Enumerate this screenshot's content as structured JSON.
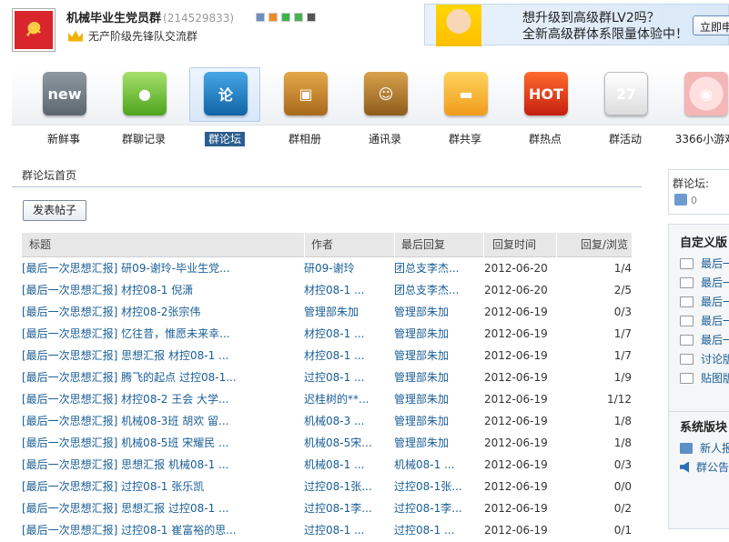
{
  "group": {
    "name": "机械毕业生党员群",
    "id": "(214529833)",
    "subtitle": "无产阶级先锋队交流群"
  },
  "banner": {
    "line1": "想升级到高级群LV2吗？",
    "line2": "全新高级群体系限量体验中！",
    "button": "立即申"
  },
  "tools": [
    {
      "label": "新鲜事",
      "icon": "new-icon",
      "glyph": "new"
    },
    {
      "label": "群聊记录",
      "icon": "chat-icon",
      "glyph": "●"
    },
    {
      "label": "群论坛",
      "icon": "forum-icon",
      "glyph": "论"
    },
    {
      "label": "群相册",
      "icon": "album-icon",
      "glyph": "▣"
    },
    {
      "label": "通讯录",
      "icon": "contacts-icon",
      "glyph": "☺"
    },
    {
      "label": "群共享",
      "icon": "share-icon",
      "glyph": "▬"
    },
    {
      "label": "群热点",
      "icon": "hot-icon",
      "glyph": "HOT"
    },
    {
      "label": "群活动",
      "icon": "event-icon",
      "glyph": "27"
    },
    {
      "label": "3366小游戏",
      "icon": "game-icon",
      "glyph": "◉"
    }
  ],
  "breadcrumb": "群论坛首页",
  "post_button": "发表帖子",
  "table": {
    "headers": [
      "标题",
      "作者",
      "最后回复",
      "回复时间",
      "回复/浏览"
    ],
    "rows": [
      [
        "[最后一次思想汇报] 研09-谢玲-毕业生党...",
        "研09-谢玲",
        "团总支李杰...",
        "2012-06-20",
        "1/4"
      ],
      [
        "[最后一次思想汇报] 材控08-1 倪潇",
        "材控08-1 ...",
        "团总支李杰...",
        "2012-06-20",
        "2/5"
      ],
      [
        "[最后一次思想汇报] 材控08-2张宗伟",
        "管理部朱加",
        "管理部朱加",
        "2012-06-19",
        "0/3"
      ],
      [
        "[最后一次思想汇报] 忆往昔，惟愿未来幸...",
        "材控08-1 ...",
        "管理部朱加",
        "2012-06-19",
        "1/7"
      ],
      [
        "[最后一次思想汇报] 思想汇报 材控08-1 ...",
        "材控08-1 ...",
        "管理部朱加",
        "2012-06-19",
        "1/7"
      ],
      [
        "[最后一次思想汇报] 腾飞的起点 过控08-1...",
        "过控08-1 ...",
        "管理部朱加",
        "2012-06-19",
        "1/9"
      ],
      [
        "[最后一次思想汇报] 材控08-2 王会 大学...",
        "迟桂树的**...",
        "管理部朱加",
        "2012-06-19",
        "1/12"
      ],
      [
        "[最后一次思想汇报] 机械08-3班 胡欢 留...",
        "机械08-3 ...",
        "管理部朱加",
        "2012-06-19",
        "1/8"
      ],
      [
        "[最后一次思想汇报] 机械08-5班 宋耀民 ...",
        "机械08-5宋...",
        "管理部朱加",
        "2012-06-19",
        "1/8"
      ],
      [
        "[最后一次思想汇报] 思想汇报 机械08-1 ...",
        "机械08-1 ...",
        "机械08-1 ...",
        "2012-06-19",
        "0/3"
      ],
      [
        "[最后一次思想汇报] 过控08-1 张乐凯",
        "过控08-1张...",
        "过控08-1张...",
        "2012-06-19",
        "0/0"
      ],
      [
        "[最后一次思想汇报] 思想汇报 过控08-1 ...",
        "过控08-1李...",
        "过控08-1李...",
        "2012-06-19",
        "0/2"
      ],
      [
        "[最后一次思想汇报] 过控08-1 崔富裕的思...",
        "过控08-1 ...",
        "过控08-1 ...",
        "2012-06-19",
        "0/1"
      ]
    ]
  },
  "sidebar": {
    "forum_label": "群论坛:",
    "like_count": "0",
    "custom_title": "自定义版",
    "custom_items": [
      "最后一",
      "最后一",
      "最后一",
      "最后一",
      "最后一",
      "讨论版",
      "贴图版"
    ],
    "system_title": "系统版块",
    "system_items": [
      "新人报",
      "群公告"
    ]
  },
  "colors": {
    "link": "#1a5e96",
    "active_tab": "#2b5d8e"
  }
}
